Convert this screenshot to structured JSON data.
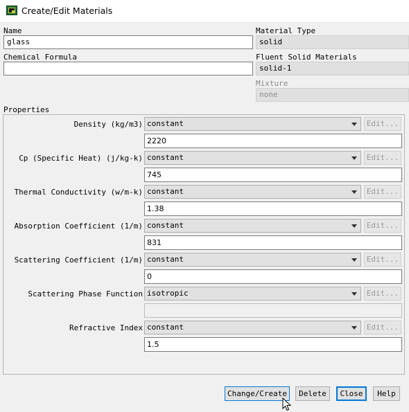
{
  "window": {
    "title": "Create/Edit Materials",
    "icon": "fluent-app-icon"
  },
  "name": {
    "label": "Name",
    "value": "glass"
  },
  "chemical_formula": {
    "label": "Chemical Formula",
    "value": ""
  },
  "material_type": {
    "label": "Material Type",
    "value": "solid"
  },
  "fluent_materials": {
    "label": "Fluent Solid Materials",
    "value": "solid-1"
  },
  "mixture": {
    "label": "Mixture",
    "value": "none"
  },
  "properties": {
    "label": "Properties",
    "items": [
      {
        "label": "Density (kg/m3)",
        "method": "constant",
        "value": "2220",
        "edit": "Edit..."
      },
      {
        "label": "Cp (Specific Heat) (j/kg-k)",
        "method": "constant",
        "value": "745",
        "edit": "Edit..."
      },
      {
        "label": "Thermal Conductivity (w/m-k)",
        "method": "constant",
        "value": "1.38",
        "edit": "Edit..."
      },
      {
        "label": "Absorption Coefficient (1/m)",
        "method": "constant",
        "value": "831",
        "edit": "Edit..."
      },
      {
        "label": "Scattering Coefficient (1/m)",
        "method": "constant",
        "value": "0",
        "edit": "Edit..."
      },
      {
        "label": "Scattering Phase Function",
        "method": "isotropic",
        "value": "",
        "edit": "Edit..."
      },
      {
        "label": "Refractive Index",
        "method": "constant",
        "value": "1.5",
        "edit": "Edit..."
      }
    ]
  },
  "buttons": {
    "change_create": "Change/Create",
    "delete": "Delete",
    "close": "Close",
    "help": "Help"
  }
}
